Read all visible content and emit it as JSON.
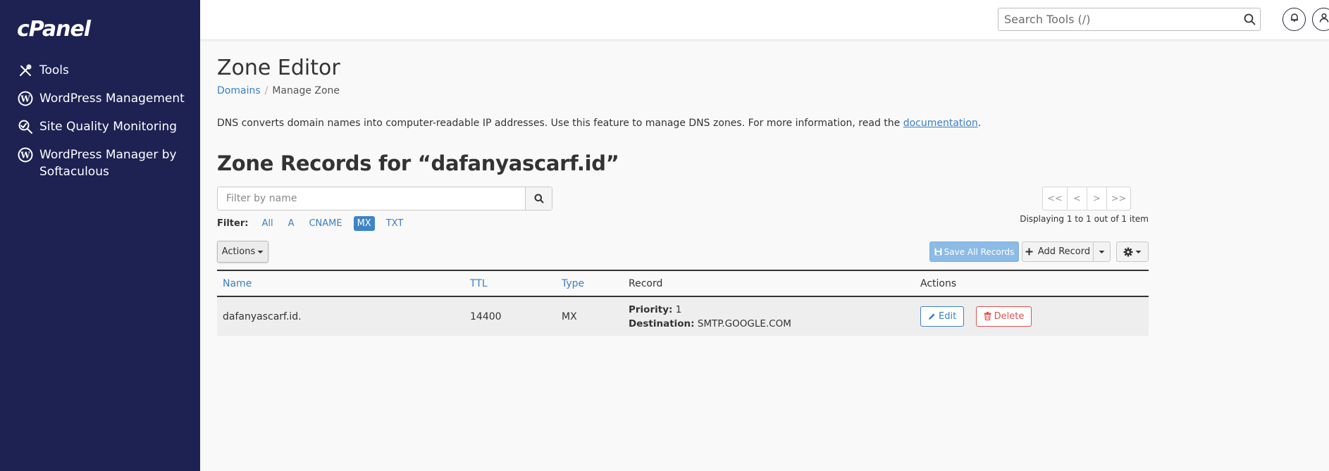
{
  "brand": {
    "logo_text": "cPanel"
  },
  "sidebar": {
    "items": [
      {
        "label": "Tools",
        "icon": "tools-icon"
      },
      {
        "label": "WordPress Management",
        "icon": "wordpress-icon"
      },
      {
        "label": "Site Quality Monitoring",
        "icon": "site-quality-icon"
      },
      {
        "label": "WordPress Manager by Softaculous",
        "icon": "wordpress-icon"
      }
    ]
  },
  "topbar": {
    "search_placeholder": "Search Tools (/)",
    "icons": [
      "search-icon",
      "bell-icon",
      "user-icon"
    ]
  },
  "page": {
    "title": "Zone Editor",
    "breadcrumb": {
      "parent": "Domains",
      "current": "Manage Zone"
    },
    "description_text": "DNS converts domain names into computer-readable IP addresses. Use this feature to manage DNS zones. For more information, read the ",
    "description_link": "documentation",
    "description_end": "."
  },
  "zone": {
    "title": "Zone Records for “dafanyascarf.id”",
    "filter_placeholder": "Filter by name",
    "filter_label": "Filter:",
    "filter_options": [
      "All",
      "A",
      "CNAME",
      "MX",
      "TXT"
    ],
    "filter_active": "MX",
    "pager": [
      "<<",
      "<",
      ">",
      ">>"
    ],
    "displaying": "Displaying 1 to 1 out of 1 item",
    "actions_label": "Actions",
    "save_all_label": "Save All Records",
    "add_record_label": "Add Record"
  },
  "table": {
    "headers": {
      "name": "Name",
      "ttl": "TTL",
      "type": "Type",
      "record": "Record",
      "actions": "Actions"
    },
    "rows": [
      {
        "name": "dafanyascarf.id.",
        "ttl": "14400",
        "type": "MX",
        "priority_label": "Priority:",
        "priority": "1",
        "destination_label": "Destination:",
        "destination": "SMTP.GOOGLE.COM",
        "edit_label": "Edit",
        "delete_label": "Delete"
      }
    ]
  },
  "colors": {
    "sidebar_bg": "#1d2252",
    "link": "#3b7fc4",
    "active_filter": "#3d85c6",
    "save_button": "#8bbbe6",
    "delete": "#d9534f"
  }
}
